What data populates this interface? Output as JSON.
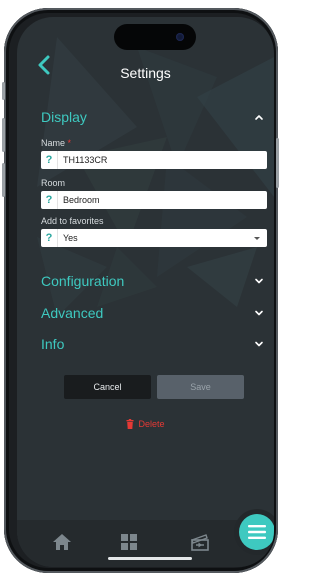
{
  "header": {
    "title": "Settings",
    "back_icon": "chevron-left-icon"
  },
  "sections": {
    "display": {
      "label": "Display",
      "expanded": true,
      "fields": {
        "name": {
          "label": "Name",
          "required_mark": "*",
          "value": "TH1133CR"
        },
        "room": {
          "label": "Room",
          "value": "Bedroom"
        },
        "favorites": {
          "label": "Add to favorites",
          "value": "Yes"
        }
      }
    },
    "configuration": {
      "label": "Configuration",
      "expanded": false
    },
    "advanced": {
      "label": "Advanced",
      "expanded": false
    },
    "info": {
      "label": "Info",
      "expanded": false
    }
  },
  "help_mark": "?",
  "actions": {
    "cancel": "Cancel",
    "save": "Save",
    "delete": "Delete"
  },
  "tabbar": {
    "items": [
      "home-icon",
      "grid-icon",
      "clapperboard-icon"
    ],
    "fab": "menu-icon"
  },
  "colors": {
    "accent": "#3ec9c0",
    "background": "#2b3236",
    "danger": "#e53935"
  }
}
